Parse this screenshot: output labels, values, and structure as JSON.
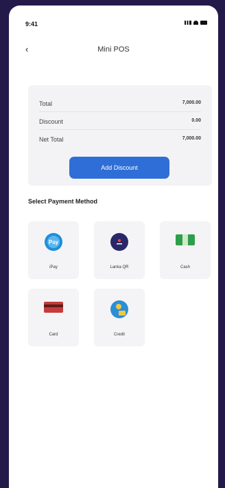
{
  "status": {
    "time": "9:41"
  },
  "header": {
    "title": "Mini POS",
    "back": "‹"
  },
  "summary": {
    "rows": [
      {
        "label": "Total",
        "value": "7,000.00"
      },
      {
        "label": "Discount",
        "value": "0.00"
      },
      {
        "label": "Net Total",
        "value": "7,000.00"
      }
    ],
    "button": "Add Discount"
  },
  "payment": {
    "title": "Select Payment Method",
    "methods": [
      {
        "label": "iPay",
        "icon": "ipay-icon"
      },
      {
        "label": "Lanka QR",
        "icon": "lanka-qr-icon"
      },
      {
        "label": "Cash",
        "icon": "cash-icon"
      },
      {
        "label": "Card",
        "icon": "card-icon"
      },
      {
        "label": "Credit",
        "icon": "credit-icon"
      }
    ]
  },
  "colors": {
    "primary": "#2f6ed6",
    "background": "#241a4a"
  }
}
